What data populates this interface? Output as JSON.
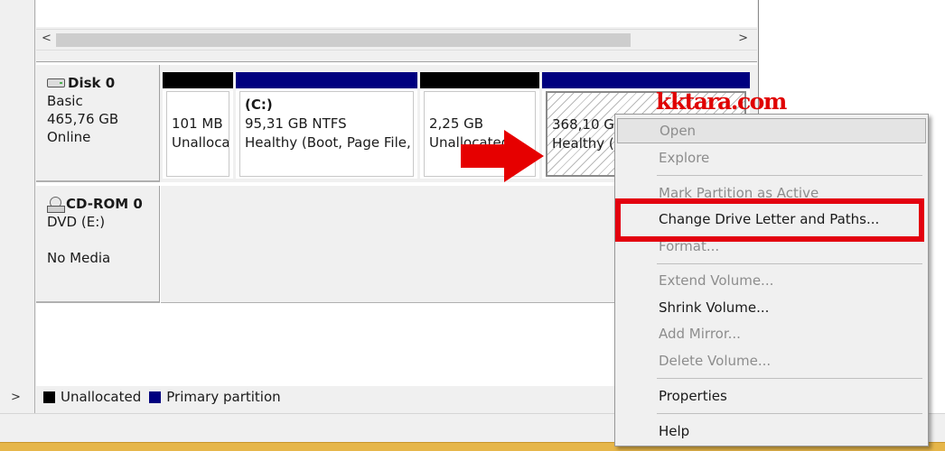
{
  "colors": {
    "unallocated": "#000000",
    "primary_partition": "#00007f",
    "highlight_box": "#e3000f",
    "arrow": "#e60000",
    "watermark": "#e00000"
  },
  "navigation": {
    "expand_arrow": ">",
    "scroll_left": "<",
    "scroll_right": ">"
  },
  "disks": {
    "disk0": {
      "name": "Disk 0",
      "type": "Basic",
      "size": "465,76 GB",
      "status": "Online",
      "icon": "hard-drive-icon",
      "partitions": [
        {
          "bar": "unallocated",
          "title": "",
          "line1": "101 MB",
          "line2": "Unalloca"
        },
        {
          "bar": "primary",
          "title": "(C:)",
          "line1": "95,31 GB NTFS",
          "line2": "Healthy (Boot, Page File, C"
        },
        {
          "bar": "unallocated",
          "title": "",
          "line1": "2,25 GB",
          "line2": "Unallocated"
        },
        {
          "bar": "primary",
          "title": "",
          "line1": "368,10 GB",
          "line2": "Healthy (S"
        }
      ]
    },
    "cdrom0": {
      "name": "CD-ROM 0",
      "drive": "DVD (E:)",
      "status": "No Media",
      "icon": "cd-drive-icon"
    }
  },
  "legend": {
    "unallocated": "Unallocated",
    "primary": "Primary partition"
  },
  "watermark": "kktara.com",
  "context_menu": {
    "open": "Open",
    "explore": "Explore",
    "mark_active": "Mark Partition as Active",
    "change_letter": "Change Drive Letter and Paths...",
    "format": "Format...",
    "extend": "Extend Volume...",
    "shrink": "Shrink Volume...",
    "add_mirror": "Add Mirror...",
    "delete": "Delete Volume...",
    "properties": "Properties",
    "help": "Help"
  }
}
